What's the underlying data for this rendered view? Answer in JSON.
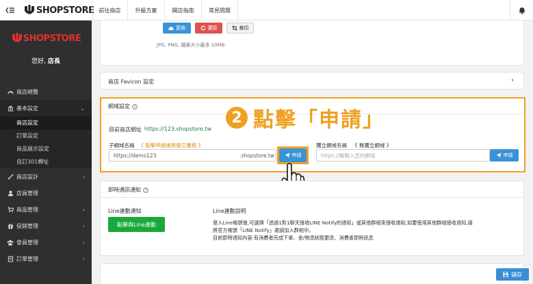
{
  "topbar": {
    "menu_icon": "≡",
    "back_icon": "‹",
    "brand": "SHOPSTORE",
    "nav": [
      "前往商店",
      "升級方案",
      "開店指南",
      "常見問題"
    ]
  },
  "sidebar": {
    "brand": "SHOPSTORE",
    "greeting_prefix": "您好,",
    "greeting_name": "店長",
    "items": [
      {
        "label": "商店總覽",
        "icon": "dashboard-icon"
      },
      {
        "label": "基本設定",
        "icon": "bank-icon",
        "open": true,
        "subs": [
          "商店設定",
          "訂單設定",
          "商品展示設定",
          "自訂301轉址"
        ]
      },
      {
        "label": "商店設計",
        "icon": "brush-icon"
      },
      {
        "label": "店員管理",
        "icon": "user-icon"
      },
      {
        "label": "商品管理",
        "icon": "cart-icon"
      },
      {
        "label": "促銷管理",
        "icon": "gift-icon"
      },
      {
        "label": "會員管理",
        "icon": "users-icon"
      },
      {
        "label": "訂單管理",
        "icon": "order-icon"
      }
    ]
  },
  "upload": {
    "change_label": "更換",
    "remove_label": "還原",
    "crop_label": "裁切",
    "hint": "JPG, PNG, 檔案大小最多 10MB"
  },
  "favicon": {
    "title": "商店 Favicon 設定"
  },
  "domain": {
    "title": "網域設定",
    "current_label": "目前商店網址",
    "current_url": "https://123.shopstore.tw",
    "sub_label": "子網域名稱",
    "sub_note": "《 點擊申請後將提交審核 》",
    "sub_value": "https://demo123",
    "sub_suffix": ".shopstore.tw",
    "apply_label": "申請",
    "own_label": "獨立網域名稱",
    "own_note": "《 無獨立網域 》",
    "own_placeholder": "https://輸輸入您的網域",
    "own_apply_label": "申請"
  },
  "annotation": {
    "number": "2",
    "text": "點擊「申請」"
  },
  "notify": {
    "title": "即時通訊通知",
    "line_label": "Line連動通知",
    "line_button": "點擊與Line連動",
    "desc_title": "Line連動說明",
    "desc_1": "登入Line帳號後,可選擇「透過1對1聊天接收LINE Notify的通知」或其他群組來接收通知;如要使用其他群組接收通知,請",
    "desc_2": "將官方帳號「LINE Notify」邀請加入群組中。",
    "desc_3": "目前即時通知內容:有消費者完成下單、金/物流狀態更改、消費者即時訊息"
  },
  "footer": {
    "save_label": "儲存"
  },
  "colors": {
    "sidebar_bg": "#2f2f2f",
    "accent_orange": "#f0a020",
    "primary_blue": "#3a93d6",
    "danger_red": "#e05050",
    "line_green": "#1aa83a",
    "brand_red": "#e03030"
  }
}
